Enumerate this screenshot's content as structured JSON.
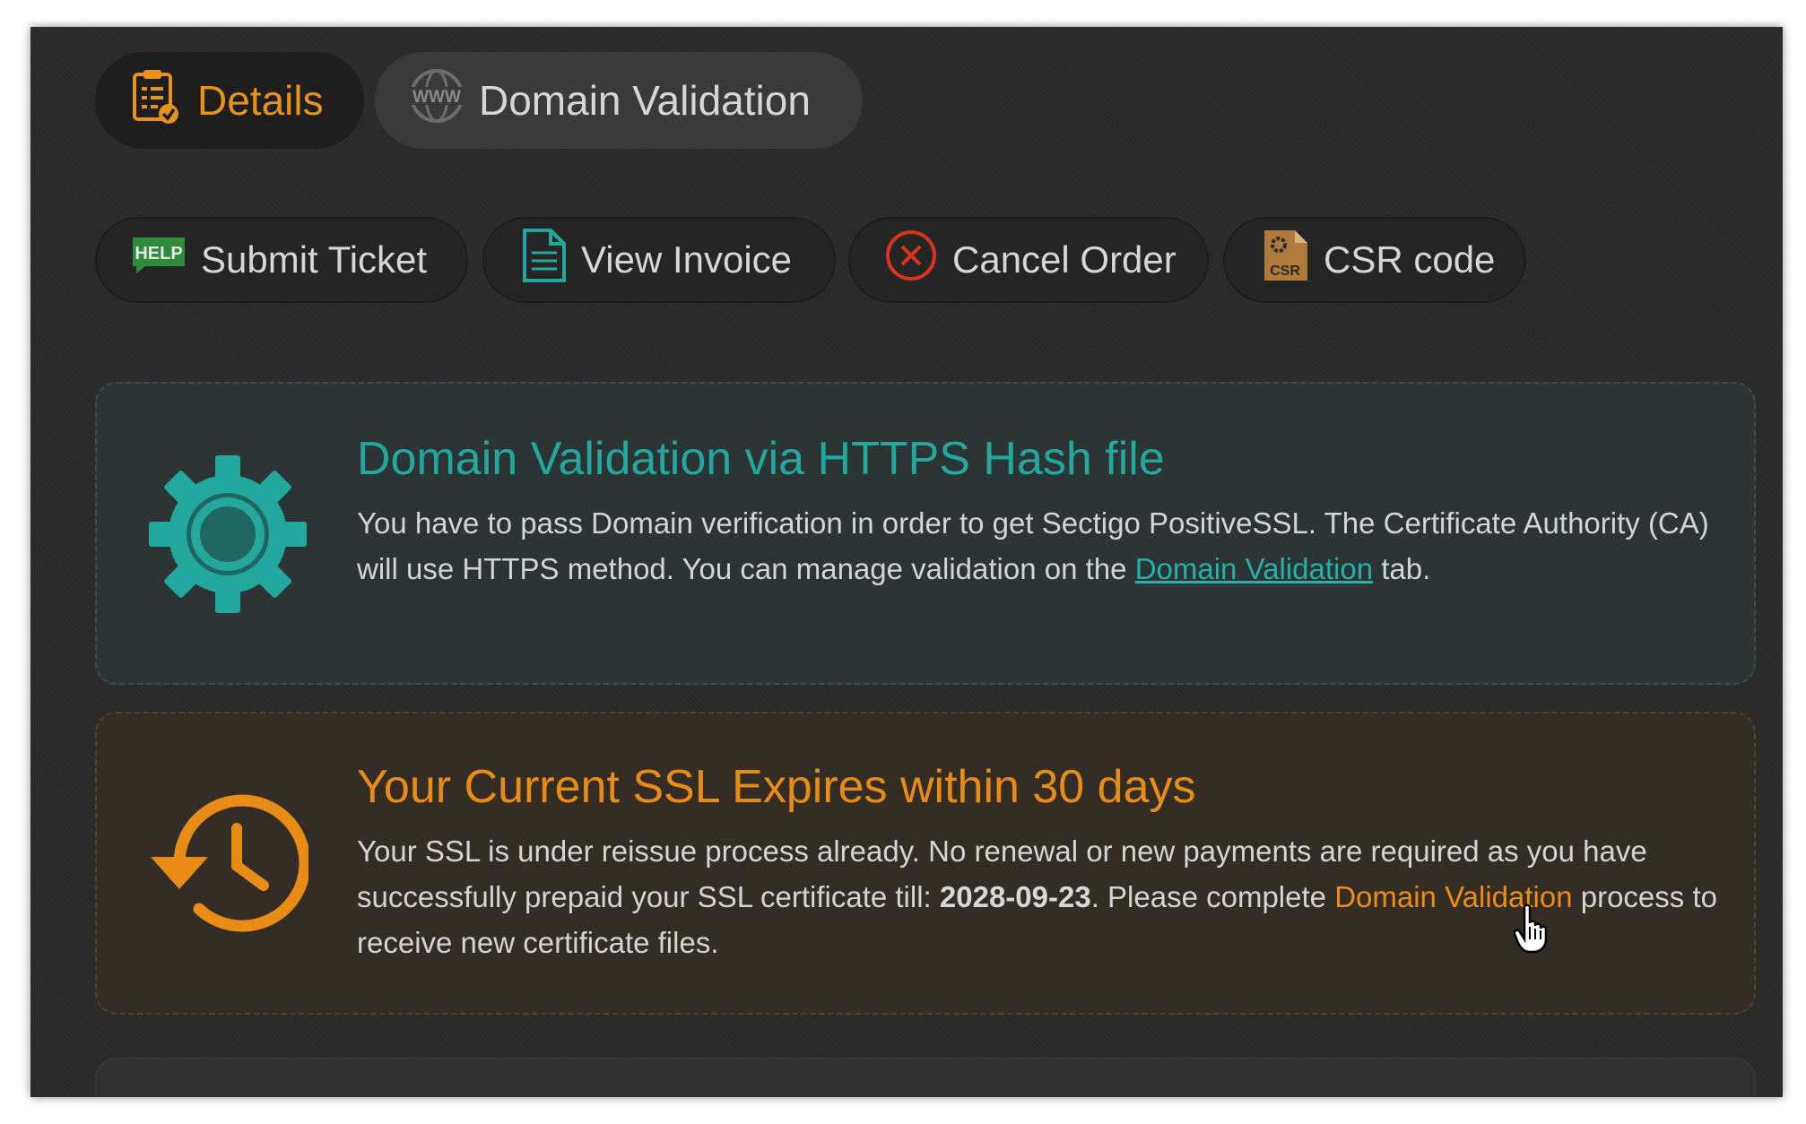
{
  "tabs": [
    {
      "label": "Details",
      "icon": "clipboard-check-icon",
      "active": true
    },
    {
      "label": "Domain Validation",
      "icon": "www-globe-icon",
      "active": false
    }
  ],
  "actions": [
    {
      "label": "Submit Ticket",
      "icon": "help-icon",
      "icon_text": "HELP"
    },
    {
      "label": "View Invoice",
      "icon": "document-icon"
    },
    {
      "label": "Cancel Order",
      "icon": "cancel-circle-icon"
    },
    {
      "label": "CSR code",
      "icon": "csr-file-icon",
      "icon_text": "CSR"
    }
  ],
  "validation_card": {
    "title": "Domain Validation via HTTPS Hash file",
    "text_before": "You have to pass Domain verification in order to get Sectigo PositiveSSL. The Certificate Authority (CA) will use HTTPS method. You can manage validation on the ",
    "link": "Domain Validation",
    "text_after": " tab.",
    "icon": "gear-icon"
  },
  "expiry_card": {
    "title": "Your Current SSL Expires within 30 days",
    "text_before": "Your SSL is under reissue process already. No renewal or new payments are required as you have successfully prepaid your SSL certificate till: ",
    "date": "2028-09-23",
    "text_middle": ". Please complete ",
    "link": "Domain Validation",
    "text_after": " process to receive new certificate files.",
    "icon": "history-clock-icon"
  },
  "colors": {
    "accent_orange": "#e8911b",
    "accent_teal": "#23a8a0",
    "cancel_red": "#d9341f",
    "help_green": "#2e8b3a",
    "background": "#2b2b2b"
  }
}
